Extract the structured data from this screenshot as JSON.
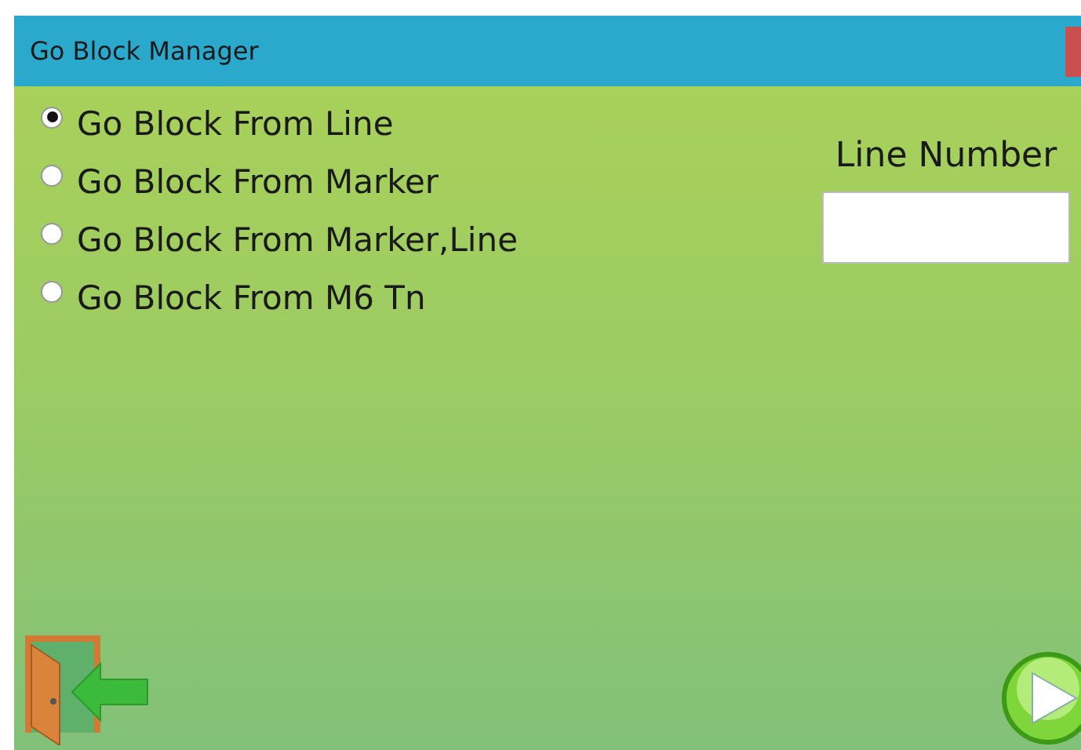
{
  "window": {
    "title": "Go Block Manager"
  },
  "options": [
    {
      "label": "Go Block From Line",
      "selected": true
    },
    {
      "label": "Go Block From Marker",
      "selected": false
    },
    {
      "label": "Go Block From Marker,Line",
      "selected": false
    },
    {
      "label": "Go Block From M6 Tn",
      "selected": false
    }
  ],
  "line_number": {
    "label": "Line Number"
  }
}
